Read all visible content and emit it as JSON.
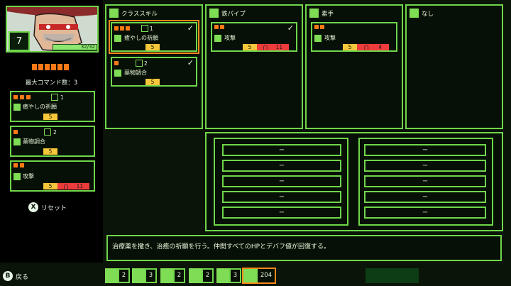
{
  "character": {
    "level": "7",
    "hp": "32/32",
    "portrait_icon": "character-portrait"
  },
  "left": {
    "max_commands_label": "最大コマンド数：3",
    "cost_pips": 6,
    "commands": [
      {
        "cost": 3,
        "slot_num": "1",
        "name": "癒やしの祈願",
        "value": "5",
        "has_red": false
      },
      {
        "cost": 1,
        "slot_num": "2",
        "name": "薬物調合",
        "value": "5",
        "has_red": false
      },
      {
        "cost": 2,
        "slot_num": "",
        "name": "攻撃",
        "value": "5",
        "has_red": true,
        "red_value": "11"
      }
    ],
    "reset_button": "X",
    "reset_label": "リセット"
  },
  "columns": [
    {
      "title": "クラススキル",
      "icon": "class-skill-icon",
      "skills": [
        {
          "cost": 3,
          "slot_num": "1",
          "name": "癒やしの祈願",
          "value": "5",
          "checked": true,
          "selected": true
        },
        {
          "cost": 1,
          "slot_num": "2",
          "name": "薬物調合",
          "value": "5",
          "checked": true,
          "selected": false
        }
      ]
    },
    {
      "title": "鉄パイプ",
      "icon": "iron-pipe-icon",
      "skills": [
        {
          "cost": 2,
          "name": "攻撃",
          "value": "5",
          "red_value": "11",
          "checked": true
        }
      ]
    },
    {
      "title": "素手",
      "icon": "bare-hands-icon",
      "skills": [
        {
          "cost": 2,
          "name": "攻撃",
          "value": "5",
          "red_value": "4",
          "checked": false
        }
      ]
    },
    {
      "title": "なし",
      "icon": "eye-icon",
      "skills": []
    }
  ],
  "slots_left": [
    "ー",
    "ー",
    "ー",
    "ー",
    "ー"
  ],
  "slots_right": [
    "ー",
    "ー",
    "ー",
    "ー",
    "ー"
  ],
  "description": "治療薬を撒き、治癒の祈願を行う。仲間すべてのHPとデバフ値が回復する。",
  "bottom": {
    "back_button": "B",
    "back_label": "戻る",
    "items": [
      {
        "icon": "medicine-bottle-icon",
        "count": "2"
      },
      {
        "icon": "bullet-icon",
        "count": "3"
      },
      {
        "icon": "cone-icon",
        "count": "2"
      },
      {
        "icon": "battery-icon",
        "count": "2"
      },
      {
        "icon": "tools-icon",
        "count": "3"
      }
    ],
    "money_icon": "money-icon",
    "money": "204"
  },
  "colors": {
    "accent_green": "#6fd64a",
    "cost_orange": "#ff7a16",
    "value_yellow": "#f6c63b",
    "damage_red": "#ee3c3c"
  }
}
